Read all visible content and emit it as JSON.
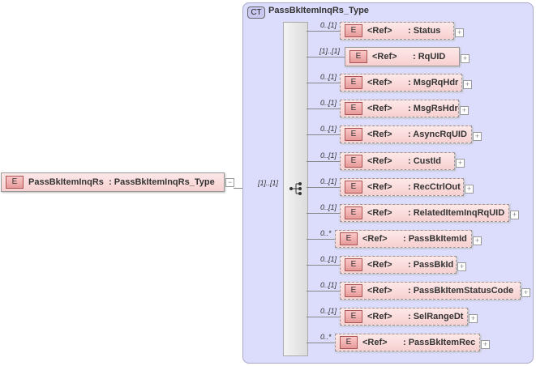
{
  "root": {
    "badge": "E",
    "name": "PassBkItemInqRs",
    "type": ": PassBkItemInqRs_Type",
    "occurrence": "[1]..[1]"
  },
  "complex_type": {
    "badge": "CT",
    "title": "PassBkItemInqRs_Type"
  },
  "children": [
    {
      "occ": "0..[1]",
      "ref": "<Ref>",
      "name": ": Status",
      "w": 141,
      "req": false
    },
    {
      "occ": "[1]..[1]",
      "ref": "<Ref>",
      "name": ": RqUID",
      "w": 142,
      "req": true
    },
    {
      "occ": "0..[1]",
      "ref": "<Ref>",
      "name": ": MsgRqHdr",
      "w": 151,
      "req": false
    },
    {
      "occ": "0..[1]",
      "ref": "<Ref>",
      "name": ": MsgRsHdr",
      "w": 147,
      "req": false
    },
    {
      "occ": "0..[1]",
      "ref": "<Ref>",
      "name": ": AsyncRqUID",
      "w": 163,
      "req": false
    },
    {
      "occ": "0..[1]",
      "ref": "<Ref>",
      "name": ": CustId",
      "w": 142,
      "req": false
    },
    {
      "occ": "0..[1]",
      "ref": "<Ref>",
      "name": ": RecCtrlOut",
      "w": 153,
      "req": false
    },
    {
      "occ": "0..[1]",
      "ref": "<Ref>",
      "name": ": RelatedItemInqRqUID",
      "w": 209,
      "req": false
    },
    {
      "occ": "0..*",
      "ref": "<Ref>",
      "name": ": PassBkItemId",
      "w": 169,
      "req": false
    },
    {
      "occ": "0..[1]",
      "ref": "<Ref>",
      "name": ": PassBkId",
      "w": 144,
      "req": false
    },
    {
      "occ": "0..[1]",
      "ref": "<Ref>",
      "name": ": PassBkItemStatusCode",
      "w": 223,
      "req": false
    },
    {
      "occ": "0..[1]",
      "ref": "<Ref>",
      "name": ": SelRangeDt",
      "w": 158,
      "req": false
    },
    {
      "occ": "0..*",
      "ref": "<Ref>",
      "name": ": PassBkItemRec",
      "w": 179,
      "req": false
    }
  ]
}
